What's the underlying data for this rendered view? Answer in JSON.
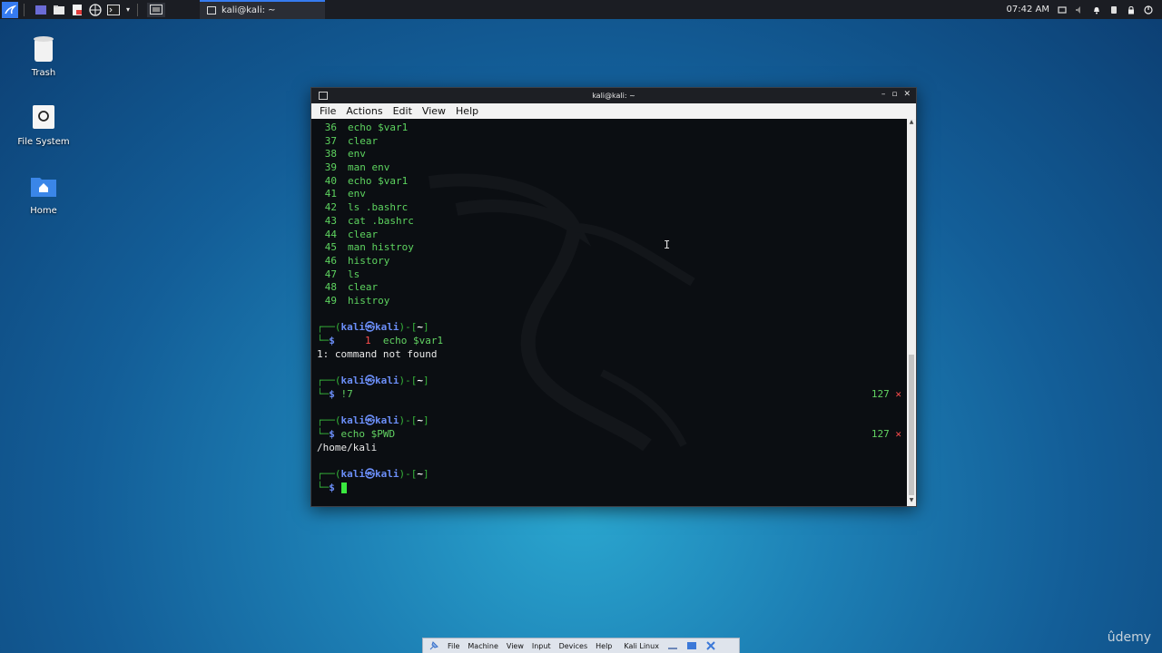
{
  "topbar": {
    "task_title": "kali@kali: ~",
    "clock": "07:42 AM",
    "launcher_icons": [
      "kali-menu-icon",
      "workspace-icon",
      "file-manager-icon",
      "text-editor-icon",
      "browser-icon",
      "terminal-icon"
    ]
  },
  "desktop": {
    "icons": [
      {
        "label": "Trash"
      },
      {
        "label": "File System"
      },
      {
        "label": "Home"
      }
    ]
  },
  "window": {
    "title": "kali@kali: ~",
    "menu": [
      "File",
      "Actions",
      "Edit",
      "View",
      "Help"
    ]
  },
  "terminal": {
    "history": [
      {
        "num": "36",
        "cmd": "echo $var1"
      },
      {
        "num": "37",
        "cmd": "clear"
      },
      {
        "num": "38",
        "cmd": "env"
      },
      {
        "num": "39",
        "cmd": "man env"
      },
      {
        "num": "40",
        "cmd": "echo $var1"
      },
      {
        "num": "41",
        "cmd": "env"
      },
      {
        "num": "42",
        "cmd": "ls .bashrc"
      },
      {
        "num": "43",
        "cmd": "cat .bashrc"
      },
      {
        "num": "44",
        "cmd": "clear"
      },
      {
        "num": "45",
        "cmd": "man histroy"
      },
      {
        "num": "46",
        "cmd": "history"
      },
      {
        "num": "47",
        "cmd": "ls"
      },
      {
        "num": "48",
        "cmd": "clear"
      },
      {
        "num": "49",
        "cmd": "histroy"
      }
    ],
    "prompt": {
      "user": "kali",
      "at": "㉿",
      "host": "kali",
      "dir": "~"
    },
    "block1": {
      "cmd_num": "1",
      "cmd": "echo $var1",
      "output": "1: command not found"
    },
    "block2": {
      "cmd": "!7",
      "status": "127"
    },
    "block3": {
      "cmd": "echo $PWD",
      "status": "127",
      "output": "/home/kali"
    },
    "status_mark": "✕"
  },
  "vbox_menu": [
    "File",
    "Machine",
    "View",
    "Input",
    "Devices",
    "Help",
    "Kali Linux"
  ],
  "watermark": "ûdemy"
}
